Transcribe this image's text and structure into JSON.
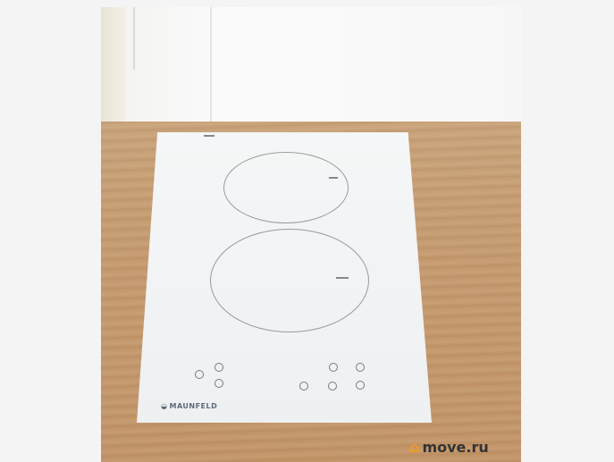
{
  "photo": {
    "brand_label": "MAUNFELD",
    "watermark_text": "move.ru",
    "icons": [
      "house-logo-icon",
      "brand-logo-icon"
    ],
    "colors": {
      "counter": "#c59a6f",
      "hob_glass": "#f2f3f5",
      "watermark_accent": "#f39b1c"
    }
  }
}
